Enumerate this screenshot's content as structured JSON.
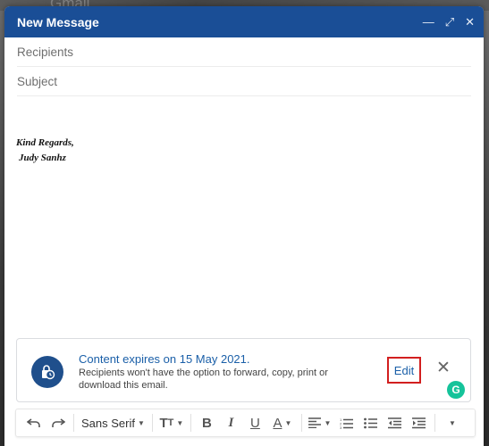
{
  "background": {
    "app_label": "Gmail"
  },
  "compose": {
    "title": "New Message",
    "recipients_placeholder": "Recipients",
    "subject_placeholder": "Subject",
    "signature": {
      "line1": "Kind Regards,",
      "line2": "Judy Sanhz"
    }
  },
  "confidential_banner": {
    "title": "Content expires on 15 May 2021.",
    "description": "Recipients won't have the option to forward, copy, print or download this email.",
    "edit_label": "Edit"
  },
  "toolbar": {
    "font_name": "Sans Serif",
    "icons": [
      "undo-icon",
      "redo-icon",
      "font-size-icon",
      "bold-icon",
      "italic-icon",
      "underline-icon",
      "text-color-icon",
      "align-icon",
      "numbered-list-icon",
      "bulleted-list-icon",
      "indent-less-icon",
      "indent-more-icon",
      "more-formatting-icon"
    ]
  },
  "colors": {
    "title_bar": "#1a4e96",
    "link": "#1a5fa8",
    "highlight_box": "#d21f1f",
    "grammarly": "#15c39a"
  }
}
